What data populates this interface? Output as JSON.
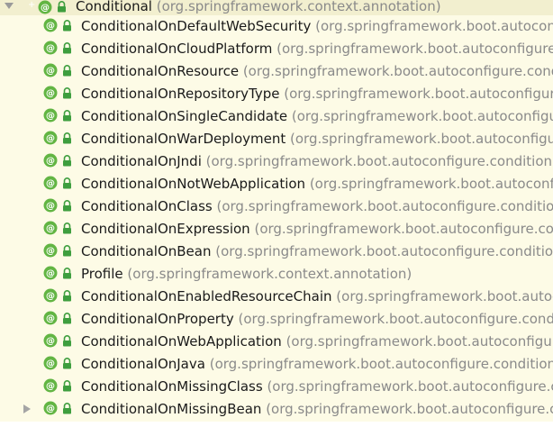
{
  "tree": {
    "root": {
      "name": "Conditional",
      "package": "(org.springframework.context.annotation)",
      "icon": "annotation-icon",
      "access_icon": "lock-icon",
      "expanded": true
    },
    "children": [
      {
        "name": "ConditionalOnDefaultWebSecurity",
        "package": "(org.springframework.boot.autoconfigure.security)"
      },
      {
        "name": "ConditionalOnCloudPlatform",
        "package": "(org.springframework.boot.autoconfigure.condition)"
      },
      {
        "name": "ConditionalOnResource",
        "package": "(org.springframework.boot.autoconfigure.condition)"
      },
      {
        "name": "ConditionalOnRepositoryType",
        "package": "(org.springframework.boot.autoconfigure.data)"
      },
      {
        "name": "ConditionalOnSingleCandidate",
        "package": "(org.springframework.boot.autoconfigure.condition)"
      },
      {
        "name": "ConditionalOnWarDeployment",
        "package": "(org.springframework.boot.autoconfigure.condition)"
      },
      {
        "name": "ConditionalOnJndi",
        "package": "(org.springframework.boot.autoconfigure.condition)"
      },
      {
        "name": "ConditionalOnNotWebApplication",
        "package": "(org.springframework.boot.autoconfigure.condition)"
      },
      {
        "name": "ConditionalOnClass",
        "package": "(org.springframework.boot.autoconfigure.condition)"
      },
      {
        "name": "ConditionalOnExpression",
        "package": "(org.springframework.boot.autoconfigure.condition)"
      },
      {
        "name": "ConditionalOnBean",
        "package": "(org.springframework.boot.autoconfigure.condition)"
      },
      {
        "name": "Profile",
        "package": "(org.springframework.context.annotation)"
      },
      {
        "name": "ConditionalOnEnabledResourceChain",
        "package": "(org.springframework.boot.autoconfigure.web)"
      },
      {
        "name": "ConditionalOnProperty",
        "package": "(org.springframework.boot.autoconfigure.condition)"
      },
      {
        "name": "ConditionalOnWebApplication",
        "package": "(org.springframework.boot.autoconfigure.condition)"
      },
      {
        "name": "ConditionalOnJava",
        "package": "(org.springframework.boot.autoconfigure.condition)"
      },
      {
        "name": "ConditionalOnMissingClass",
        "package": "(org.springframework.boot.autoconfigure.condition)"
      },
      {
        "name": "ConditionalOnMissingBean",
        "package": "(org.springframework.boot.autoconfigure.condition)",
        "collapsed": true
      }
    ],
    "colors": {
      "background": "#FDFBE6",
      "selected_row": "#F2EFCF",
      "annotation_green": "#62B543",
      "lock_green": "#3E9E3E",
      "name_text": "#1A1A1A",
      "package_text": "#8A8A8A"
    }
  }
}
